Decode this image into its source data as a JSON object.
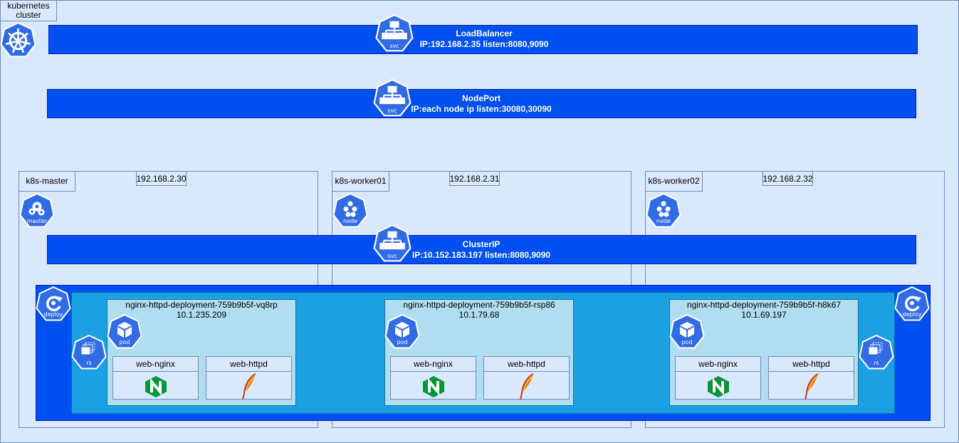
{
  "cluster": {
    "label": "kubernetes\ncluster"
  },
  "colors": {
    "cluster_fill": "#dae8fc",
    "cluster_stroke": "#6c8ebf",
    "service_bar": "#0050ef",
    "replicaset_area": "#1ba1e2",
    "pod_fill": "#b1ddf0",
    "k8s_icon_blue": "#326ce5",
    "nginx_green": "#009639"
  },
  "services": [
    {
      "type": "LoadBalancer",
      "detail": "IP:192.168.2.35 listen:8080,9090",
      "icon_label": "svc"
    },
    {
      "type": "NodePort",
      "detail": "IP:each node ip listen:30080,30090",
      "icon_label": "svc"
    },
    {
      "type": "ClusterIP",
      "detail": "IP:10.152.183.197 listen:8080,9090",
      "icon_label": "svc"
    }
  ],
  "nodes": [
    {
      "name": "k8s-master",
      "ip": "192.168.2.30",
      "icon_label": "master"
    },
    {
      "name": "k8s-worker01",
      "ip": "192.168.2.31",
      "icon_label": "node"
    },
    {
      "name": "k8s-worker02",
      "ip": "192.168.2.32",
      "icon_label": "node"
    }
  ],
  "deploy_icon_label": "deploy",
  "rs_icon_label": "rs",
  "pods": [
    {
      "name": "nginx-httpd-deployment-759b9b5f-vq8rp",
      "ip": "10.1.235.209",
      "icon_label": "pod",
      "containers": [
        "web-nginx",
        "web-httpd"
      ]
    },
    {
      "name": "nginx-httpd-deployment-759b9b5f-rsp86",
      "ip": "10.1.79.68",
      "icon_label": "pod",
      "containers": [
        "web-nginx",
        "web-httpd"
      ]
    },
    {
      "name": "nginx-httpd-deployment-759b9b5f-h8k67",
      "ip": "10.1.69.197",
      "icon_label": "pod",
      "containers": [
        "web-nginx",
        "web-httpd"
      ]
    }
  ],
  "icons": {
    "cluster": "kubernetes-helm-icon",
    "svc": "kubernetes-service-icon",
    "master": "kubernetes-master-icon",
    "node": "kubernetes-node-icon",
    "deploy": "kubernetes-deployment-icon",
    "rs": "kubernetes-replicaset-icon",
    "pod": "kubernetes-pod-icon",
    "nginx": "nginx-logo-icon",
    "httpd": "apache-feather-icon"
  }
}
